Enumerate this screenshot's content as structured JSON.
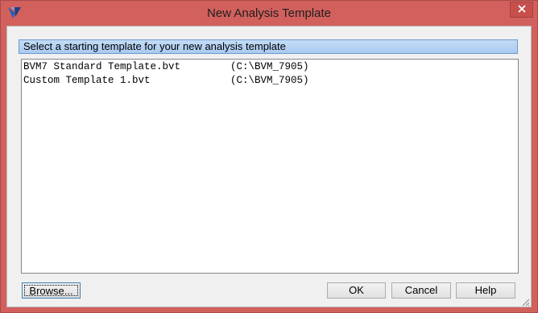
{
  "window": {
    "title": "New Analysis Template",
    "icons": {
      "app": "app-logo-icon",
      "close": "close-icon",
      "grip": "resize-grip-icon"
    },
    "colors": {
      "frame": "#d2605d",
      "close": "#c7504d",
      "header": "#b5d2f3"
    }
  },
  "header": {
    "text": "Select a starting template for your new analysis template"
  },
  "templates": [
    {
      "name": "BVM7 Standard Template.bvt",
      "path": "(C:\\BVM_7905)"
    },
    {
      "name": "Custom Template 1.bvt",
      "path": "(C:\\BVM_7905)"
    }
  ],
  "buttons": {
    "browse": "Browse...",
    "ok": "OK",
    "cancel": "Cancel",
    "help": "Help"
  }
}
